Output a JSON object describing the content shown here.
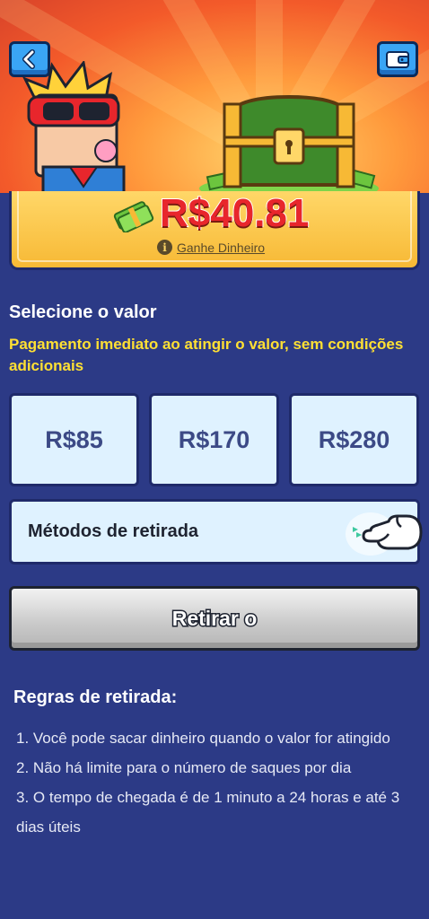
{
  "header": {
    "back_icon": "chevron-left-icon",
    "wallet_icon": "wallet-icon"
  },
  "balance": {
    "amount": "R$40.81",
    "earn_link": "Ganhe Dinheiro",
    "info_icon": "info-icon"
  },
  "select": {
    "title": "Selecione o valor",
    "subtitle": "Pagamento imediato ao atingir o valor, sem condições adicionais",
    "options": [
      "R$85",
      "R$170",
      "R$280"
    ]
  },
  "methods": {
    "label": "Métodos de retirada"
  },
  "withdraw_button": {
    "label": "Retirar o"
  },
  "rules": {
    "title": "Regras de retirada:",
    "items": [
      "1. Você pode sacar dinheiro quando o valor for atingido",
      "2. Não há limite para o número de saques por dia",
      "3. O tempo de chegada é de 1 minuto a 24 horas e até 3 dias úteis"
    ]
  },
  "colors": {
    "background": "#2c3a86",
    "amount_red": "#e8262c",
    "subtitle_yellow": "#ffe033",
    "option_bg": "#dff2ff"
  }
}
